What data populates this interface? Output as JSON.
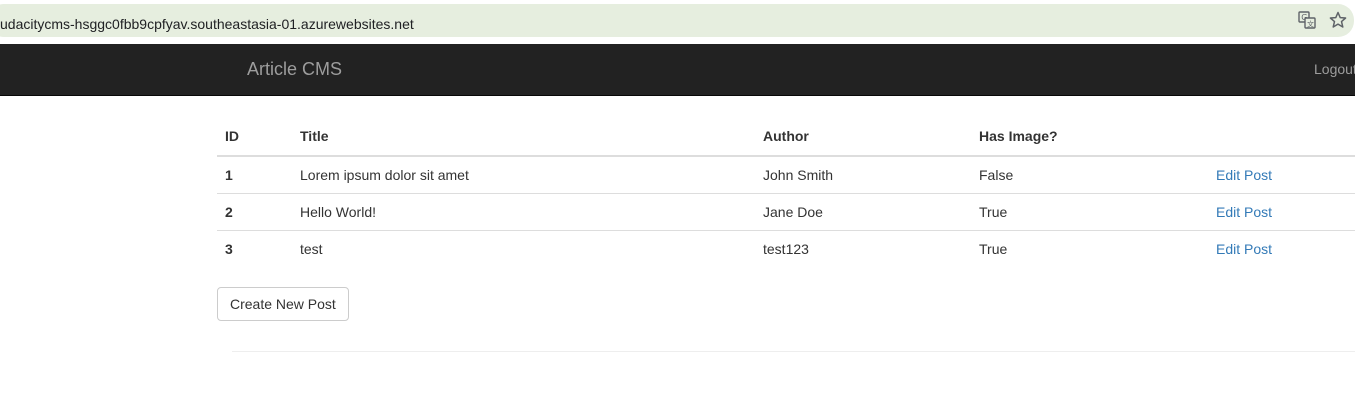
{
  "browser": {
    "url": "udacitycms-hsggc0fbb9cpfyav.southeastasia-01.azurewebsites.net",
    "icons": [
      "translate-icon",
      "star-icon"
    ]
  },
  "navbar": {
    "brand": "Article CMS",
    "logout_label": "Logout"
  },
  "table": {
    "headers": {
      "id": "ID",
      "title": "Title",
      "author": "Author",
      "has_image": "Has Image?",
      "action": ""
    },
    "rows": [
      {
        "id": "1",
        "title": "Lorem ipsum dolor sit amet",
        "author": "John Smith",
        "has_image": "False",
        "action": "Edit Post"
      },
      {
        "id": "2",
        "title": "Hello World!",
        "author": "Jane Doe",
        "has_image": "True",
        "action": "Edit Post"
      },
      {
        "id": "3",
        "title": "test",
        "author": "test123",
        "has_image": "True",
        "action": "Edit Post"
      }
    ]
  },
  "create_button_label": "Create New Post",
  "colors": {
    "navbar_bg": "#222222",
    "navbar_text": "#9d9d9d",
    "link": "#337ab7",
    "address_bar_bg": "#e6eedf"
  }
}
